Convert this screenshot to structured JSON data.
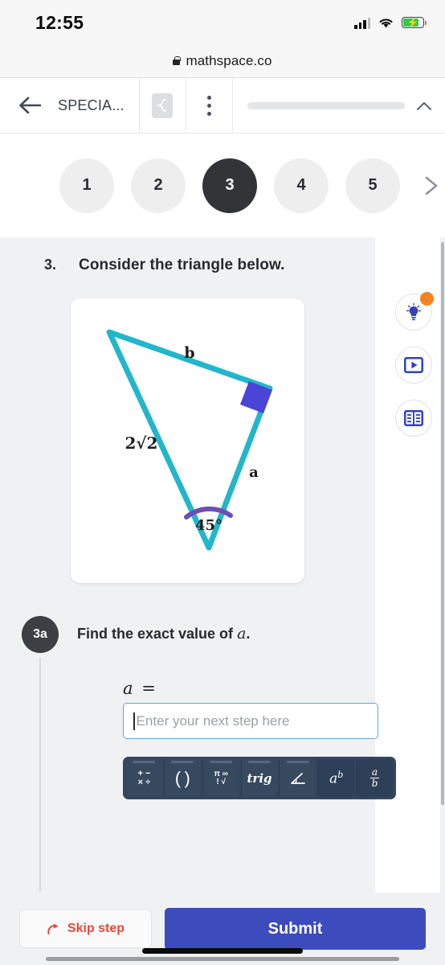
{
  "status_bar": {
    "time": "12:55",
    "signal_icon": "signal-bars-icon",
    "wifi_icon": "wifi-icon",
    "battery_icon": "battery-charging-icon"
  },
  "browser": {
    "lock_icon": "lock-icon",
    "url": "mathspace.co"
  },
  "app_header": {
    "back_icon": "back-arrow-icon",
    "title": "SPECIA...",
    "workbook_icon": "scribble-icon",
    "menu_icon": "vertical-dots-icon",
    "collapse_icon": "chevron-up-icon"
  },
  "steps": {
    "items": [
      {
        "label": "1",
        "active": false
      },
      {
        "label": "2",
        "active": false
      },
      {
        "label": "3",
        "active": true
      },
      {
        "label": "4",
        "active": false
      },
      {
        "label": "5",
        "active": false
      }
    ],
    "next_icon": "chevron-right-icon"
  },
  "question": {
    "number": "3.",
    "prompt": "Consider the triangle below."
  },
  "diagram": {
    "shape": "right-triangle",
    "stroke_color": "#23b6cb",
    "right_angle_color": "#4a45d6",
    "arc_color": "#6b4fb5",
    "labels": {
      "top_side": "b",
      "left_side": "2√2",
      "right_side": "a",
      "angle": "45°"
    }
  },
  "side_actions": [
    {
      "name": "hint-button",
      "icon": "lightbulb-icon",
      "badge": true
    },
    {
      "name": "video-button",
      "icon": "play-video-icon",
      "badge": false
    },
    {
      "name": "reference-button",
      "icon": "book-icon",
      "badge": false
    }
  ],
  "substep": {
    "badge": "3a",
    "text_before": "Find the exact value of",
    "variable": "a",
    "text_after": ".",
    "equation_label": "a =",
    "input_placeholder": "Enter your next step here",
    "input_value": ""
  },
  "math_keypad": {
    "keys": [
      {
        "name": "operators-key",
        "glyph": "+ − × ÷"
      },
      {
        "name": "parentheses-key",
        "glyph": "( )"
      },
      {
        "name": "symbols-key",
        "glyph": "π ∞ ! √"
      },
      {
        "name": "trig-key",
        "glyph": "trig"
      },
      {
        "name": "angle-key",
        "glyph": "∠"
      },
      {
        "name": "exponent-key",
        "glyph": "aᵇ"
      },
      {
        "name": "fraction-key",
        "glyph": "a/b"
      }
    ]
  },
  "footer": {
    "skip_icon": "skip-step-icon",
    "skip_label": "Skip step",
    "submit_label": "Submit"
  },
  "colors": {
    "accent_blue": "#3c4cbd",
    "teal": "#23b6cb",
    "skip_red": "#e24b3a",
    "badge_orange": "#f5821f",
    "keypad_bg": "#33465e"
  }
}
